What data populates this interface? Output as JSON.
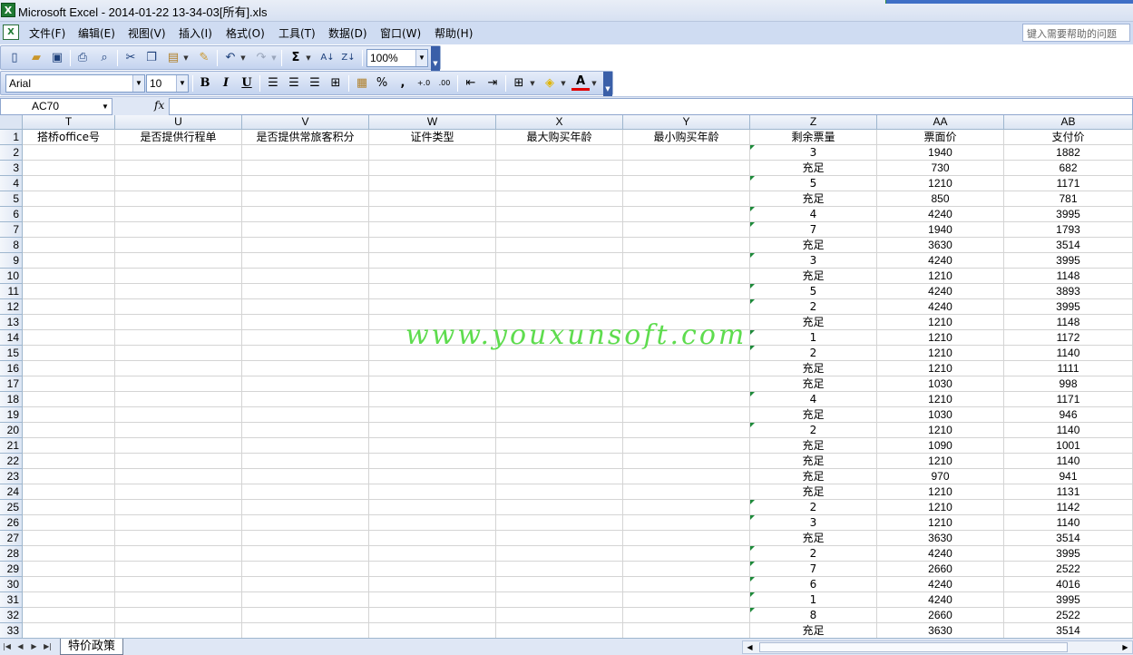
{
  "window": {
    "title": "Microsoft Excel - 2014-01-22 13-34-03[所有].xls",
    "app_icon": "excel-icon"
  },
  "menu": {
    "items": [
      "文件(F)",
      "编辑(E)",
      "视图(V)",
      "插入(I)",
      "格式(O)",
      "工具(T)",
      "数据(D)",
      "窗口(W)",
      "帮助(H)"
    ],
    "help_placeholder": "键入需要帮助的问题"
  },
  "toolbar": {
    "zoom": "100%",
    "font_name": "Arial",
    "font_size": "10",
    "bold": "B",
    "italic": "I",
    "underline": "U",
    "percent": "%",
    "comma": ",",
    "inc_decimal": "+.0\n.00",
    "sum": "Σ"
  },
  "formula_bar": {
    "name_box": "AC70",
    "fx": "fx",
    "value": ""
  },
  "columns": [
    "T",
    "U",
    "V",
    "W",
    "X",
    "Y",
    "Z",
    "AA",
    "AB"
  ],
  "header_row": [
    "搭桥office号",
    "是否提供行程单",
    "是否提供常旅客积分",
    "证件类型",
    "最大购买年龄",
    "最小购买年龄",
    "剩余票量",
    "票面价",
    "支付价"
  ],
  "rows": [
    {
      "z": "3",
      "aa": "1940",
      "ab": "1882",
      "flag": true
    },
    {
      "z": "充足",
      "aa": "730",
      "ab": "682",
      "flag": false
    },
    {
      "z": "5",
      "aa": "1210",
      "ab": "1171",
      "flag": true
    },
    {
      "z": "充足",
      "aa": "850",
      "ab": "781",
      "flag": false
    },
    {
      "z": "4",
      "aa": "4240",
      "ab": "3995",
      "flag": true
    },
    {
      "z": "7",
      "aa": "1940",
      "ab": "1793",
      "flag": true
    },
    {
      "z": "充足",
      "aa": "3630",
      "ab": "3514",
      "flag": false
    },
    {
      "z": "3",
      "aa": "4240",
      "ab": "3995",
      "flag": true
    },
    {
      "z": "充足",
      "aa": "1210",
      "ab": "1148",
      "flag": false
    },
    {
      "z": "5",
      "aa": "4240",
      "ab": "3893",
      "flag": true
    },
    {
      "z": "2",
      "aa": "4240",
      "ab": "3995",
      "flag": true
    },
    {
      "z": "充足",
      "aa": "1210",
      "ab": "1148",
      "flag": false
    },
    {
      "z": "1",
      "aa": "1210",
      "ab": "1172",
      "flag": true
    },
    {
      "z": "2",
      "aa": "1210",
      "ab": "1140",
      "flag": true
    },
    {
      "z": "充足",
      "aa": "1210",
      "ab": "1111",
      "flag": false
    },
    {
      "z": "充足",
      "aa": "1030",
      "ab": "998",
      "flag": false
    },
    {
      "z": "4",
      "aa": "1210",
      "ab": "1171",
      "flag": true
    },
    {
      "z": "充足",
      "aa": "1030",
      "ab": "946",
      "flag": false
    },
    {
      "z": "2",
      "aa": "1210",
      "ab": "1140",
      "flag": true
    },
    {
      "z": "充足",
      "aa": "1090",
      "ab": "1001",
      "flag": false
    },
    {
      "z": "充足",
      "aa": "1210",
      "ab": "1140",
      "flag": false
    },
    {
      "z": "充足",
      "aa": "970",
      "ab": "941",
      "flag": false
    },
    {
      "z": "充足",
      "aa": "1210",
      "ab": "1131",
      "flag": false
    },
    {
      "z": "2",
      "aa": "1210",
      "ab": "1142",
      "flag": true
    },
    {
      "z": "3",
      "aa": "1210",
      "ab": "1140",
      "flag": true
    },
    {
      "z": "充足",
      "aa": "3630",
      "ab": "3514",
      "flag": false
    },
    {
      "z": "2",
      "aa": "4240",
      "ab": "3995",
      "flag": true
    },
    {
      "z": "7",
      "aa": "2660",
      "ab": "2522",
      "flag": true
    },
    {
      "z": "6",
      "aa": "4240",
      "ab": "4016",
      "flag": true
    },
    {
      "z": "1",
      "aa": "4240",
      "ab": "3995",
      "flag": true
    },
    {
      "z": "8",
      "aa": "2660",
      "ab": "2522",
      "flag": true
    },
    {
      "z": "充足",
      "aa": "3630",
      "ab": "3514",
      "flag": false
    }
  ],
  "watermark": "www.youxunsoft.com",
  "sheet_tabs": [
    "特价政策"
  ],
  "colors": {
    "menubar": "#cfdcf2",
    "header_bg": "#dce5f3",
    "watermark": "#5edc4e",
    "error_flag": "#1d8a3a"
  }
}
